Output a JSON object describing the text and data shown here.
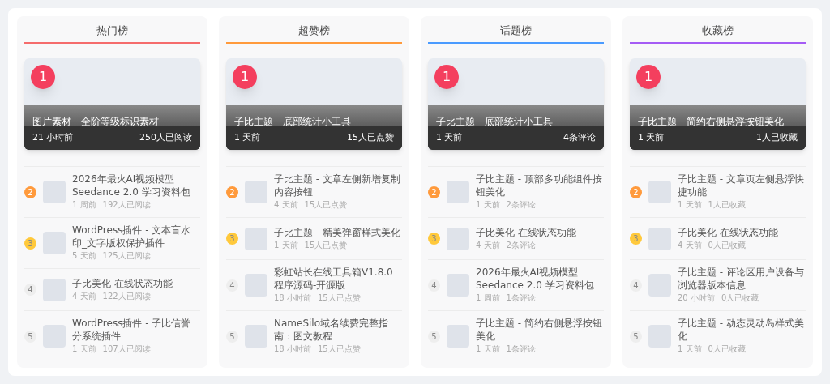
{
  "boards": [
    {
      "title": "热门榜",
      "color": "#f56c6c",
      "featured": {
        "rank": "1",
        "title": "图片素材 - 全阶等级标识素材",
        "time": "21 小时前",
        "stat": "250人已阅读"
      },
      "items": [
        {
          "rank": "2",
          "color": "#ff9a3c",
          "title": "2026年最火AI视频模型Seedance 2.0 学习资料包",
          "time": "1 周前",
          "stat": "192人已阅读"
        },
        {
          "rank": "3",
          "color": "#ffc93c",
          "title": "WordPress插件 - 文本盲水印_文字版权保护插件",
          "time": "5 天前",
          "stat": "125人已阅读"
        },
        {
          "rank": "4",
          "color": "#eeeeee",
          "title": "子比美化-在线状态功能",
          "time": "4 天前",
          "stat": "122人已阅读"
        },
        {
          "rank": "5",
          "color": "#eeeeee",
          "title": "WordPress插件 - 子比信誉分系统插件",
          "time": "1 天前",
          "stat": "107人已阅读"
        }
      ]
    },
    {
      "title": "超赞榜",
      "color": "#ff9a3c",
      "featured": {
        "rank": "1",
        "title": "子比主题 - 底部统计小工具",
        "time": "1 天前",
        "stat": "15人已点赞"
      },
      "items": [
        {
          "rank": "2",
          "color": "#ff9a3c",
          "title": "子比主题 - 文章左侧新增复制内容按钮",
          "time": "4 天前",
          "stat": "15人已点赞"
        },
        {
          "rank": "3",
          "color": "#ffc93c",
          "title": "子比主题 - 精美弹窗样式美化",
          "time": "1 天前",
          "stat": "15人已点赞"
        },
        {
          "rank": "4",
          "color": "#eeeeee",
          "title": "彩虹站长在线工具箱V1.8.0程序源码-开源版",
          "time": "18 小时前",
          "stat": "15人已点赞"
        },
        {
          "rank": "5",
          "color": "#eeeeee",
          "title": "NameSilo域名续费完整指南：图文教程",
          "time": "18 小时前",
          "stat": "15人已点赞"
        }
      ]
    },
    {
      "title": "话题榜",
      "color": "#4a9bff",
      "featured": {
        "rank": "1",
        "title": "子比主题 - 底部统计小工具",
        "time": "1 天前",
        "stat": "4条评论"
      },
      "items": [
        {
          "rank": "2",
          "color": "#ff9a3c",
          "title": "子比主题 - 顶部多功能组件按钮美化",
          "time": "1 天前",
          "stat": "2条评论"
        },
        {
          "rank": "3",
          "color": "#ffc93c",
          "title": "子比美化-在线状态功能",
          "time": "4 天前",
          "stat": "2条评论"
        },
        {
          "rank": "4",
          "color": "#eeeeee",
          "title": "2026年最火AI视频模型Seedance 2.0 学习资料包",
          "time": "1 周前",
          "stat": "1条评论"
        },
        {
          "rank": "5",
          "color": "#eeeeee",
          "title": "子比主题 - 简约右侧悬浮按钮美化",
          "time": "1 天前",
          "stat": "1条评论"
        }
      ]
    },
    {
      "title": "收藏榜",
      "color": "#a55cf5",
      "featured": {
        "rank": "1",
        "title": "子比主题 - 简约右侧悬浮按钮美化",
        "time": "1 天前",
        "stat": "1人已收藏"
      },
      "items": [
        {
          "rank": "2",
          "color": "#ff9a3c",
          "title": "子比主题 - 文章页左侧悬浮快捷功能",
          "time": "1 天前",
          "stat": "1人已收藏"
        },
        {
          "rank": "3",
          "color": "#ffc93c",
          "title": "子比美化-在线状态功能",
          "time": "4 天前",
          "stat": "0人已收藏"
        },
        {
          "rank": "4",
          "color": "#eeeeee",
          "title": "子比主题 - 评论区用户设备与浏览器版本信息",
          "time": "20 小时前",
          "stat": "0人已收藏"
        },
        {
          "rank": "5",
          "color": "#eeeeee",
          "title": "子比主题 - 动态灵动岛样式美化",
          "time": "1 天前",
          "stat": "0人已收藏"
        }
      ]
    }
  ]
}
